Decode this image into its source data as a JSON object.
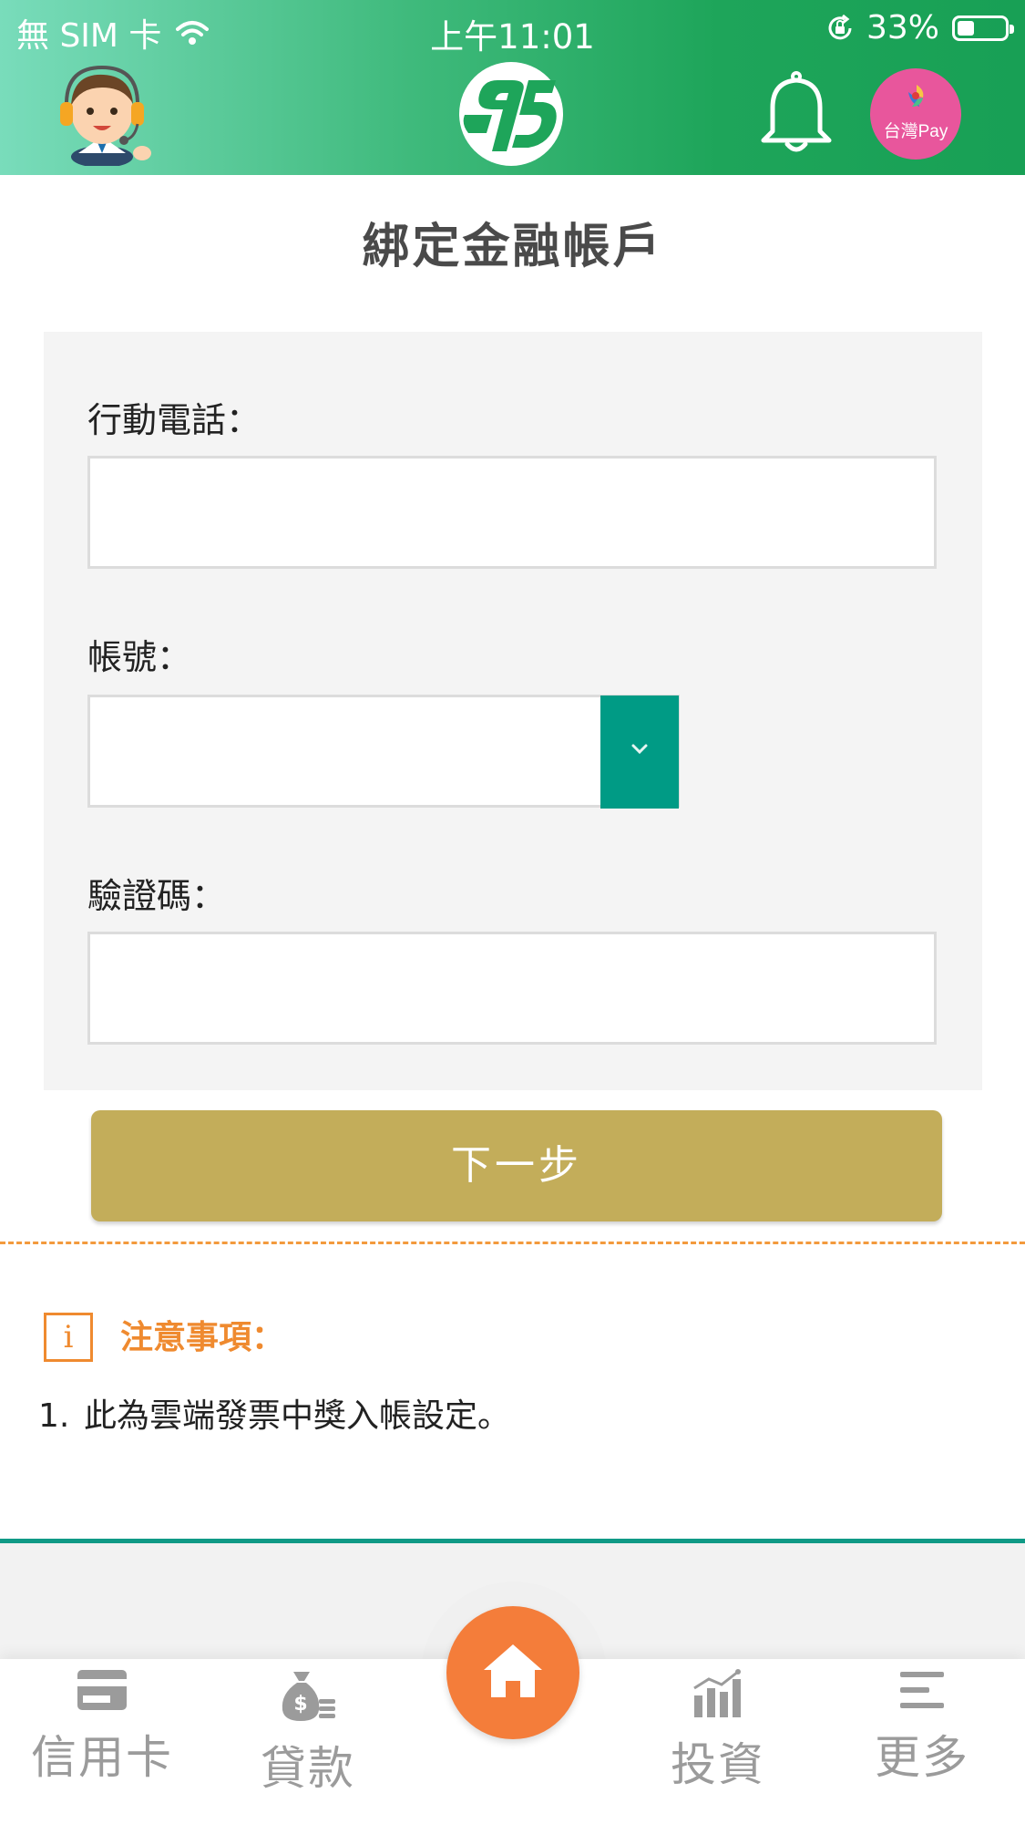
{
  "status_bar": {
    "carrier": "無 SIM 卡",
    "time": "上午11:01",
    "battery": "33%"
  },
  "header": {
    "taiwanpay_label": "台灣Pay"
  },
  "page": {
    "title": "綁定金融帳戶"
  },
  "form": {
    "phone_label": "行動電話：",
    "phone_value": "",
    "account_label": "帳號：",
    "account_value": "",
    "code_label": "驗證碼：",
    "code_value": "",
    "next_label": "下一步"
  },
  "notice": {
    "icon_letter": "i",
    "title": "注意事項：",
    "items": [
      {
        "num": "1.",
        "text": "此為雲端發票中獎入帳設定。"
      }
    ]
  },
  "bottom_nav": {
    "items": [
      {
        "label": "信用卡",
        "icon": "credit-card-icon"
      },
      {
        "label": "貸款",
        "icon": "money-bag-icon"
      },
      {
        "label": "",
        "icon": "home-icon"
      },
      {
        "label": "投資",
        "icon": "investment-chart-icon"
      },
      {
        "label": "更多",
        "icon": "menu-icon"
      }
    ]
  },
  "colors": {
    "header_green": "#18a055",
    "teal": "#009b85",
    "next_button": "#c3ad5a",
    "notice_orange": "#ef8a2f",
    "home_orange": "#f47d3a",
    "taiwanpay_pink": "#e8569c"
  }
}
